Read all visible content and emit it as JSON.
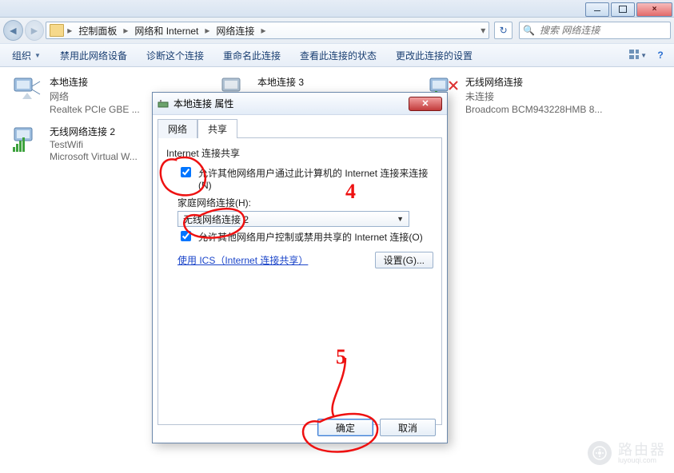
{
  "window_controls": {
    "close_glyph": "×"
  },
  "breadcrumb": {
    "items": [
      "控制面板",
      "网络和 Internet",
      "网络连接"
    ]
  },
  "addressbar": {
    "search_placeholder": "搜索 网络连接",
    "refresh_glyph": "↻",
    "search_glyph": "🔍"
  },
  "toolbar": {
    "organize": "组织",
    "btn_disable": "禁用此网络设备",
    "btn_diagnose": "诊断这个连接",
    "btn_rename": "重命名此连接",
    "btn_status": "查看此连接的状态",
    "btn_change": "更改此连接的设置",
    "tri": "▼"
  },
  "connections": [
    {
      "name": "本地连接",
      "status": "网络",
      "device": "Realtek PCIe GBE ..."
    },
    {
      "name": "本地连接 3",
      "status": "",
      "device": ""
    },
    {
      "name": "无线网络连接",
      "status": "未连接",
      "device": "Broadcom BCM943228HMB 8..."
    },
    {
      "name": "无线网络连接 2",
      "status": "TestWifi",
      "device": "Microsoft Virtual W..."
    }
  ],
  "dialog": {
    "title": "本地连接 属性",
    "tabs": {
      "networking": "网络",
      "sharing": "共享"
    },
    "group_label": "Internet 连接共享",
    "cb1_label": "允许其他网络用户通过此计算机的 Internet 连接来连接(N)",
    "home_conn_label": "家庭网络连接(H):",
    "combo_value": "无线网络连接 2",
    "cb2_label": "允许其他网络用户控制或禁用共享的 Internet 连接(O)",
    "ics_link": "使用 ICS（Internet 连接共享）",
    "settings_btn": "设置(G)...",
    "ok": "确定",
    "cancel": "取消",
    "close_glyph": "✕"
  },
  "annotations": {
    "four": "4",
    "five": "5"
  },
  "watermark": {
    "text": "路由器",
    "sub": "luyouqi.com"
  }
}
